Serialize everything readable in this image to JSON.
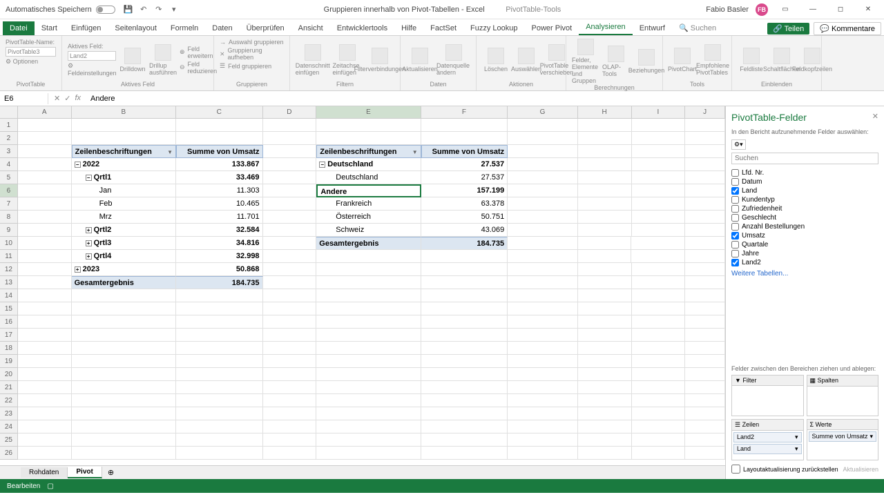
{
  "titlebar": {
    "autosave": "Automatisches Speichern",
    "doc_title": "Gruppieren innerhalb von Pivot-Tabellen - Excel",
    "tool_tab": "PivotTable-Tools",
    "user": "Fabio Basler",
    "initials": "FB"
  },
  "tabs": {
    "file": "Datei",
    "start": "Start",
    "einfuegen": "Einfügen",
    "seitenlayout": "Seitenlayout",
    "formeln": "Formeln",
    "daten": "Daten",
    "ueberpruefen": "Überprüfen",
    "ansicht": "Ansicht",
    "entwickler": "Entwicklertools",
    "hilfe": "Hilfe",
    "factset": "FactSet",
    "fuzzy": "Fuzzy Lookup",
    "powerpivot": "Power Pivot",
    "analysieren": "Analysieren",
    "entwurf": "Entwurf",
    "suchen": "Suchen",
    "teilen": "Teilen",
    "kommentare": "Kommentare"
  },
  "ribbon": {
    "pt_name_label": "PivotTable-Name:",
    "pt_name": "PivotTable3",
    "active_field_label": "Aktives Feld:",
    "active_field": "Land2",
    "optionen": "Optionen",
    "feldeinst": "Feldeinstellungen",
    "drilldown": "Drilldown",
    "drillup": "Drillup ausführen",
    "feld_erweitern": "Feld erweitern",
    "feld_reduzieren": "Feld reduzieren",
    "auswahl_grupp": "Auswahl gruppieren",
    "grupp_aufheben": "Gruppierung aufheben",
    "feld_grupp": "Feld gruppieren",
    "datenschnitt": "Datenschnitt einfügen",
    "zeitachse": "Zeitachse einfügen",
    "filterverb": "Filterverbindungen",
    "aktualisieren": "Aktualisieren",
    "datenquelle": "Datenquelle ändern",
    "loeschen": "Löschen",
    "auswaehlen": "Auswählen",
    "verschieben": "PivotTable verschieben",
    "felder": "Felder, Elemente und Gruppen",
    "olap": "OLAP-Tools",
    "beziehungen": "Beziehungen",
    "pivotchart": "PivotChart",
    "empfohlene": "Empfohlene PivotTables",
    "feldliste": "Feldliste",
    "schaltflaechen": "Schaltflächen",
    "feldkopf": "Feldkopfzeilen",
    "g_pivottable": "PivotTable",
    "g_aktives": "Aktives Feld",
    "g_gruppieren": "Gruppieren",
    "g_filtern": "Filtern",
    "g_daten": "Daten",
    "g_aktionen": "Aktionen",
    "g_berechnungen": "Berechnungen",
    "g_tools": "Tools",
    "g_einblenden": "Einblenden"
  },
  "formula": {
    "cell_ref": "E6",
    "value": "Andere"
  },
  "cols": [
    "A",
    "B",
    "C",
    "D",
    "E",
    "F",
    "G",
    "H",
    "I",
    "J"
  ],
  "pivot1": {
    "h1": "Zeilenbeschriftungen",
    "h2": "Summe von Umsatz",
    "y2022": "2022",
    "v2022": "133.867",
    "q1": "Qrtl1",
    "vq1": "33.469",
    "jan": "Jan",
    "vjan": "11.303",
    "feb": "Feb",
    "vfeb": "10.465",
    "mrz": "Mrz",
    "vmrz": "11.701",
    "q2": "Qrtl2",
    "vq2": "32.584",
    "q3": "Qrtl3",
    "vq3": "34.816",
    "q4": "Qrtl4",
    "vq4": "32.998",
    "y2023": "2023",
    "v2023": "50.868",
    "total": "Gesamtergebnis",
    "vtotal": "184.735"
  },
  "pivot2": {
    "h1": "Zeilenbeschriftungen",
    "h2": "Summe von Umsatz",
    "de": "Deutschland",
    "vde": "27.537",
    "de2": "Deutschland",
    "vde2": "27.537",
    "andere": "Andere",
    "vandere": "157.199",
    "fr": "Frankreich",
    "vfr": "63.378",
    "at": "Österreich",
    "vat": "50.751",
    "ch": "Schweiz",
    "vch": "43.069",
    "total": "Gesamtergebnis",
    "vtotal": "184.735"
  },
  "sheets": {
    "rohdaten": "Rohdaten",
    "pivot": "Pivot"
  },
  "status": "Bearbeiten",
  "pane": {
    "title": "PivotTable-Felder",
    "sub": "In den Bericht aufzunehmende Felder auswählen:",
    "search_ph": "Suchen",
    "fields": [
      {
        "label": "Lfd. Nr.",
        "checked": false
      },
      {
        "label": "Datum",
        "checked": false
      },
      {
        "label": "Land",
        "checked": true
      },
      {
        "label": "Kundentyp",
        "checked": false
      },
      {
        "label": "Zufriedenheit",
        "checked": false
      },
      {
        "label": "Geschlecht",
        "checked": false
      },
      {
        "label": "Anzahl Bestellungen",
        "checked": false
      },
      {
        "label": "Umsatz",
        "checked": true
      },
      {
        "label": "Quartale",
        "checked": false
      },
      {
        "label": "Jahre",
        "checked": false
      },
      {
        "label": "Land2",
        "checked": true
      }
    ],
    "weitere": "Weitere Tabellen...",
    "drag_label": "Felder zwischen den Bereichen ziehen und ablegen:",
    "filter": "Filter",
    "spalten": "Spalten",
    "zeilen": "Zeilen",
    "werte": "Werte",
    "zeilen_items": [
      "Land2",
      "Land"
    ],
    "werte_items": [
      "Summe von Umsatz"
    ],
    "defer": "Layoutaktualisierung zurückstellen",
    "update": "Aktualisieren"
  }
}
